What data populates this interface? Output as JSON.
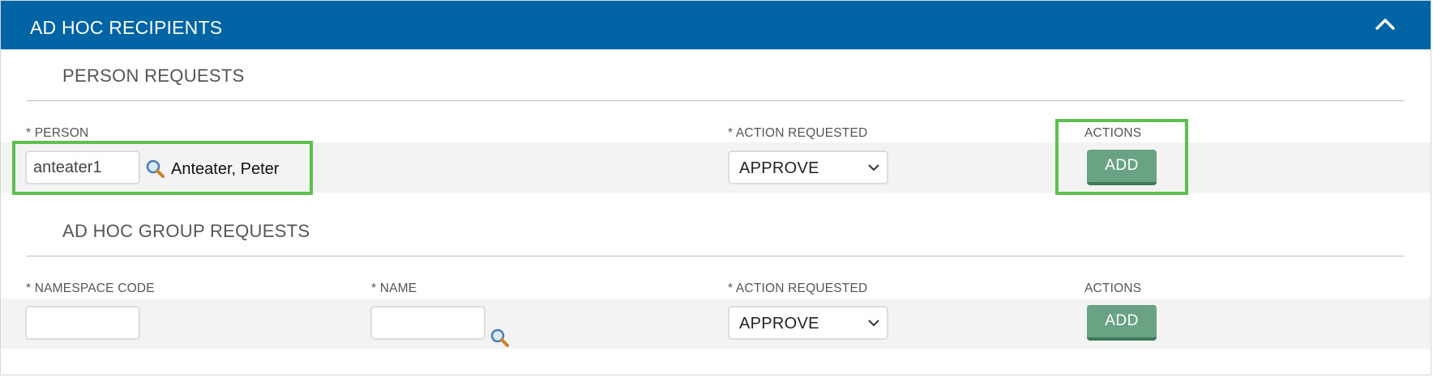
{
  "panel": {
    "title": "AD HOC RECIPIENTS",
    "collapse_icon": "chevron-up-icon"
  },
  "person_requests": {
    "title": "PERSON REQUESTS",
    "labels": {
      "person": "* PERSON",
      "action_requested": "* ACTION REQUESTED",
      "actions": "ACTIONS"
    },
    "person_id_value": "anteater1",
    "person_name": "Anteater, Peter",
    "action_value": "APPROVE",
    "add_label": "ADD"
  },
  "group_requests": {
    "title": "AD HOC GROUP REQUESTS",
    "labels": {
      "namespace_code": "* NAMESPACE CODE",
      "name": "* NAME",
      "action_requested": "* ACTION REQUESTED",
      "actions": "ACTIONS"
    },
    "namespace_value": "",
    "name_value": "",
    "action_value": "APPROVE",
    "add_label": "ADD"
  },
  "colors": {
    "header_bg": "#0064a5",
    "add_button": "#6aa384",
    "highlight": "#5dc04f"
  }
}
